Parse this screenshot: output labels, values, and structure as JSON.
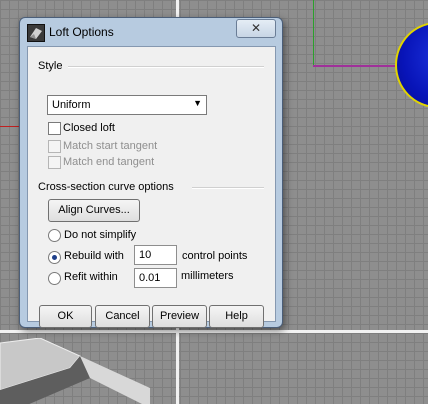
{
  "dialog": {
    "title": "Loft Options",
    "close_glyph": "✕",
    "style_group": {
      "label": "Style",
      "selected": "Uniform",
      "closed_loft": "Closed loft",
      "match_start_tangent": "Match start tangent",
      "match_end_tangent": "Match end tangent"
    },
    "cross_section_group": {
      "label": "Cross-section curve options",
      "align_curves_button": "Align Curves...",
      "do_not_simplify": "Do not simplify",
      "rebuild_with": "Rebuild with",
      "rebuild_value": "10",
      "rebuild_unit": "control points",
      "refit_within": "Refit within",
      "refit_value": "0.01",
      "refit_unit": "millimeters",
      "selected_option": "rebuild_with"
    },
    "buttons": {
      "ok": "OK",
      "cancel": "Cancel",
      "preview": "Preview",
      "help": "Help"
    }
  },
  "colors": {
    "viewport_bg": "#8e8e8e",
    "dialog_frame": "#b7cbe0",
    "client_bg": "#f0f0f0"
  }
}
